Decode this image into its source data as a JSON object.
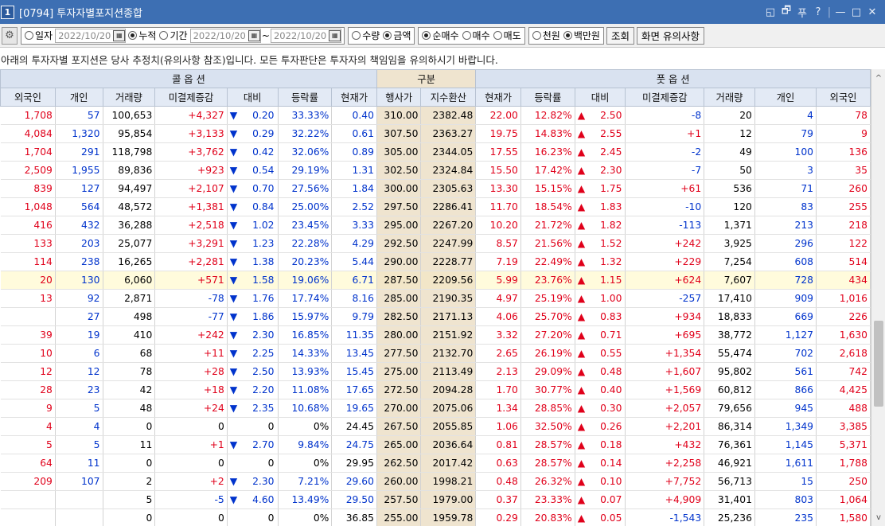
{
  "window": {
    "number": "1",
    "title": "[0794] 투자자별포지션종합",
    "controls": [
      "◱",
      "🗗",
      "푸",
      "?",
      "|",
      "—",
      "□",
      "✕"
    ]
  },
  "toolbar": {
    "period": [
      {
        "label": "일자",
        "on": false
      },
      {
        "label": "누적",
        "on": true
      },
      {
        "label": "기간",
        "on": false
      }
    ],
    "date1": "2022/10/20",
    "date2": "2022/10/20",
    "date3": "2022/10/20",
    "tilde": "~",
    "unit_type": [
      {
        "label": "수량",
        "on": false
      },
      {
        "label": "금액",
        "on": true
      }
    ],
    "trade_type": [
      {
        "label": "순매수",
        "on": true
      },
      {
        "label": "매수",
        "on": false
      },
      {
        "label": "매도",
        "on": false
      }
    ],
    "money_unit": [
      {
        "label": "천원",
        "on": false
      },
      {
        "label": "백만원",
        "on": true
      }
    ],
    "query_label": "조회",
    "notice_label": "화면 유의사항"
  },
  "notice": "아래의 투자자별 포지션은 당사 추정치(유의사항 참조)입니다. 모든 투자판단은 투자자의 책임임을 유의하시기 바랍니다.",
  "headers": {
    "call": "콜 옵 션",
    "mid": "구분",
    "put": "풋 옵 션",
    "call_cols": [
      "외국인",
      "개인",
      "거래량",
      "미결제증감",
      "대비",
      "등락률",
      "현재가"
    ],
    "mid_cols": [
      "행사가",
      "지수환산"
    ],
    "put_cols": [
      "현재가",
      "등락률",
      "대비",
      "미결제증감",
      "거래량",
      "개인",
      "외국인"
    ]
  },
  "rows": [
    {
      "c": [
        "1,708",
        "57",
        "100,653",
        "+4,327",
        "▼",
        "0.20",
        "33.33%",
        "0.40"
      ],
      "s": [
        "310.00",
        "2382.48"
      ],
      "p": [
        "22.00",
        "12.82%",
        "▲",
        "2.50",
        "-8",
        "20",
        "4",
        "78"
      ]
    },
    {
      "c": [
        "4,084",
        "1,320",
        "95,854",
        "+3,133",
        "▼",
        "0.29",
        "32.22%",
        "0.61"
      ],
      "s": [
        "307.50",
        "2363.27"
      ],
      "p": [
        "19.75",
        "14.83%",
        "▲",
        "2.55",
        "+1",
        "12",
        "79",
        "9"
      ]
    },
    {
      "c": [
        "1,704",
        "291",
        "118,798",
        "+3,762",
        "▼",
        "0.42",
        "32.06%",
        "0.89"
      ],
      "s": [
        "305.00",
        "2344.05"
      ],
      "p": [
        "17.55",
        "16.23%",
        "▲",
        "2.45",
        "-2",
        "49",
        "100",
        "136"
      ]
    },
    {
      "c": [
        "2,509",
        "1,955",
        "89,836",
        "+923",
        "▼",
        "0.54",
        "29.19%",
        "1.31"
      ],
      "s": [
        "302.50",
        "2324.84"
      ],
      "p": [
        "15.50",
        "17.42%",
        "▲",
        "2.30",
        "-7",
        "50",
        "3",
        "35"
      ]
    },
    {
      "c": [
        "839",
        "127",
        "94,497",
        "+2,107",
        "▼",
        "0.70",
        "27.56%",
        "1.84"
      ],
      "s": [
        "300.00",
        "2305.63"
      ],
      "p": [
        "13.30",
        "15.15%",
        "▲",
        "1.75",
        "+61",
        "536",
        "71",
        "260"
      ]
    },
    {
      "c": [
        "1,048",
        "564",
        "48,572",
        "+1,381",
        "▼",
        "0.84",
        "25.00%",
        "2.52"
      ],
      "s": [
        "297.50",
        "2286.41"
      ],
      "p": [
        "11.70",
        "18.54%",
        "▲",
        "1.83",
        "-10",
        "120",
        "83",
        "255"
      ]
    },
    {
      "c": [
        "416",
        "432",
        "36,288",
        "+2,518",
        "▼",
        "1.02",
        "23.45%",
        "3.33"
      ],
      "s": [
        "295.00",
        "2267.20"
      ],
      "p": [
        "10.20",
        "21.72%",
        "▲",
        "1.82",
        "-113",
        "1,371",
        "213",
        "218"
      ]
    },
    {
      "c": [
        "133",
        "203",
        "25,077",
        "+3,291",
        "▼",
        "1.23",
        "22.28%",
        "4.29"
      ],
      "s": [
        "292.50",
        "2247.99"
      ],
      "p": [
        "8.57",
        "21.56%",
        "▲",
        "1.52",
        "+242",
        "3,925",
        "296",
        "122"
      ]
    },
    {
      "c": [
        "114",
        "238",
        "16,265",
        "+2,281",
        "▼",
        "1.38",
        "20.23%",
        "5.44"
      ],
      "s": [
        "290.00",
        "2228.77"
      ],
      "p": [
        "7.19",
        "22.49%",
        "▲",
        "1.32",
        "+229",
        "7,254",
        "608",
        "514"
      ]
    },
    {
      "c": [
        "20",
        "130",
        "6,060",
        "+571",
        "▼",
        "1.58",
        "19.06%",
        "6.71"
      ],
      "s": [
        "287.50",
        "2209.56"
      ],
      "p": [
        "5.99",
        "23.76%",
        "▲",
        "1.15",
        "+624",
        "7,607",
        "728",
        "434"
      ],
      "hl": true
    },
    {
      "c": [
        "13",
        "92",
        "2,871",
        "-78",
        "▼",
        "1.76",
        "17.74%",
        "8.16"
      ],
      "s": [
        "285.00",
        "2190.35"
      ],
      "p": [
        "4.97",
        "25.19%",
        "▲",
        "1.00",
        "-257",
        "17,410",
        "909",
        "1,016"
      ]
    },
    {
      "c": [
        "",
        "27",
        "498",
        "-77",
        "▼",
        "1.86",
        "15.97%",
        "9.79"
      ],
      "s": [
        "282.50",
        "2171.13"
      ],
      "p": [
        "4.06",
        "25.70%",
        "▲",
        "0.83",
        "+934",
        "18,833",
        "669",
        "226"
      ]
    },
    {
      "c": [
        "39",
        "19",
        "410",
        "+242",
        "▼",
        "2.30",
        "16.85%",
        "11.35"
      ],
      "s": [
        "280.00",
        "2151.92"
      ],
      "p": [
        "3.32",
        "27.20%",
        "▲",
        "0.71",
        "+695",
        "38,772",
        "1,127",
        "1,630"
      ]
    },
    {
      "c": [
        "10",
        "6",
        "68",
        "+11",
        "▼",
        "2.25",
        "14.33%",
        "13.45"
      ],
      "s": [
        "277.50",
        "2132.70"
      ],
      "p": [
        "2.65",
        "26.19%",
        "▲",
        "0.55",
        "+1,354",
        "55,474",
        "702",
        "2,618"
      ]
    },
    {
      "c": [
        "12",
        "12",
        "78",
        "+28",
        "▼",
        "2.50",
        "13.93%",
        "15.45"
      ],
      "s": [
        "275.00",
        "2113.49"
      ],
      "p": [
        "2.13",
        "29.09%",
        "▲",
        "0.48",
        "+1,607",
        "95,802",
        "561",
        "742"
      ]
    },
    {
      "c": [
        "28",
        "23",
        "42",
        "+18",
        "▼",
        "2.20",
        "11.08%",
        "17.65"
      ],
      "s": [
        "272.50",
        "2094.28"
      ],
      "p": [
        "1.70",
        "30.77%",
        "▲",
        "0.40",
        "+1,569",
        "60,812",
        "866",
        "4,425"
      ]
    },
    {
      "c": [
        "9",
        "5",
        "48",
        "+24",
        "▼",
        "2.35",
        "10.68%",
        "19.65"
      ],
      "s": [
        "270.00",
        "2075.06"
      ],
      "p": [
        "1.34",
        "28.85%",
        "▲",
        "0.30",
        "+2,057",
        "79,656",
        "945",
        "488"
      ]
    },
    {
      "c": [
        "4",
        "4",
        "0",
        "0",
        "",
        "0",
        "0%",
        "24.45"
      ],
      "s": [
        "267.50",
        "2055.85"
      ],
      "p": [
        "1.06",
        "32.50%",
        "▲",
        "0.26",
        "+2,201",
        "86,314",
        "1,349",
        "3,385"
      ]
    },
    {
      "c": [
        "5",
        "5",
        "11",
        "+1",
        "▼",
        "2.70",
        "9.84%",
        "24.75"
      ],
      "s": [
        "265.00",
        "2036.64"
      ],
      "p": [
        "0.81",
        "28.57%",
        "▲",
        "0.18",
        "+432",
        "76,361",
        "1,145",
        "5,371"
      ]
    },
    {
      "c": [
        "64",
        "11",
        "0",
        "0",
        "",
        "0",
        "0%",
        "29.95"
      ],
      "s": [
        "262.50",
        "2017.42"
      ],
      "p": [
        "0.63",
        "28.57%",
        "▲",
        "0.14",
        "+2,258",
        "46,921",
        "1,611",
        "1,788"
      ]
    },
    {
      "c": [
        "209",
        "107",
        "2",
        "+2",
        "▼",
        "2.30",
        "7.21%",
        "29.60"
      ],
      "s": [
        "260.00",
        "1998.21"
      ],
      "p": [
        "0.48",
        "26.32%",
        "▲",
        "0.10",
        "+7,752",
        "56,713",
        "15",
        "250"
      ]
    },
    {
      "c": [
        "",
        "",
        "5",
        "-5",
        "▼",
        "4.60",
        "13.49%",
        "29.50"
      ],
      "s": [
        "257.50",
        "1979.00"
      ],
      "p": [
        "0.37",
        "23.33%",
        "▲",
        "0.07",
        "+4,909",
        "31,401",
        "803",
        "1,064"
      ]
    },
    {
      "c": [
        "",
        "",
        "0",
        "0",
        "",
        "0",
        "0%",
        "36.85"
      ],
      "s": [
        "255.00",
        "1959.78"
      ],
      "p": [
        "0.29",
        "20.83%",
        "▲",
        "0.05",
        "-1,543",
        "25,236",
        "235",
        "1,580"
      ]
    }
  ],
  "colors": {
    "up": "#e0001a",
    "down": "#0033cc",
    "title_bg": "#3d6fb3",
    "header_bg": "#d9e2f0",
    "strike_bg": "#efe4cf",
    "highlight_bg": "#fffbdc"
  },
  "scroll": {
    "up": "^",
    "down": "v"
  }
}
